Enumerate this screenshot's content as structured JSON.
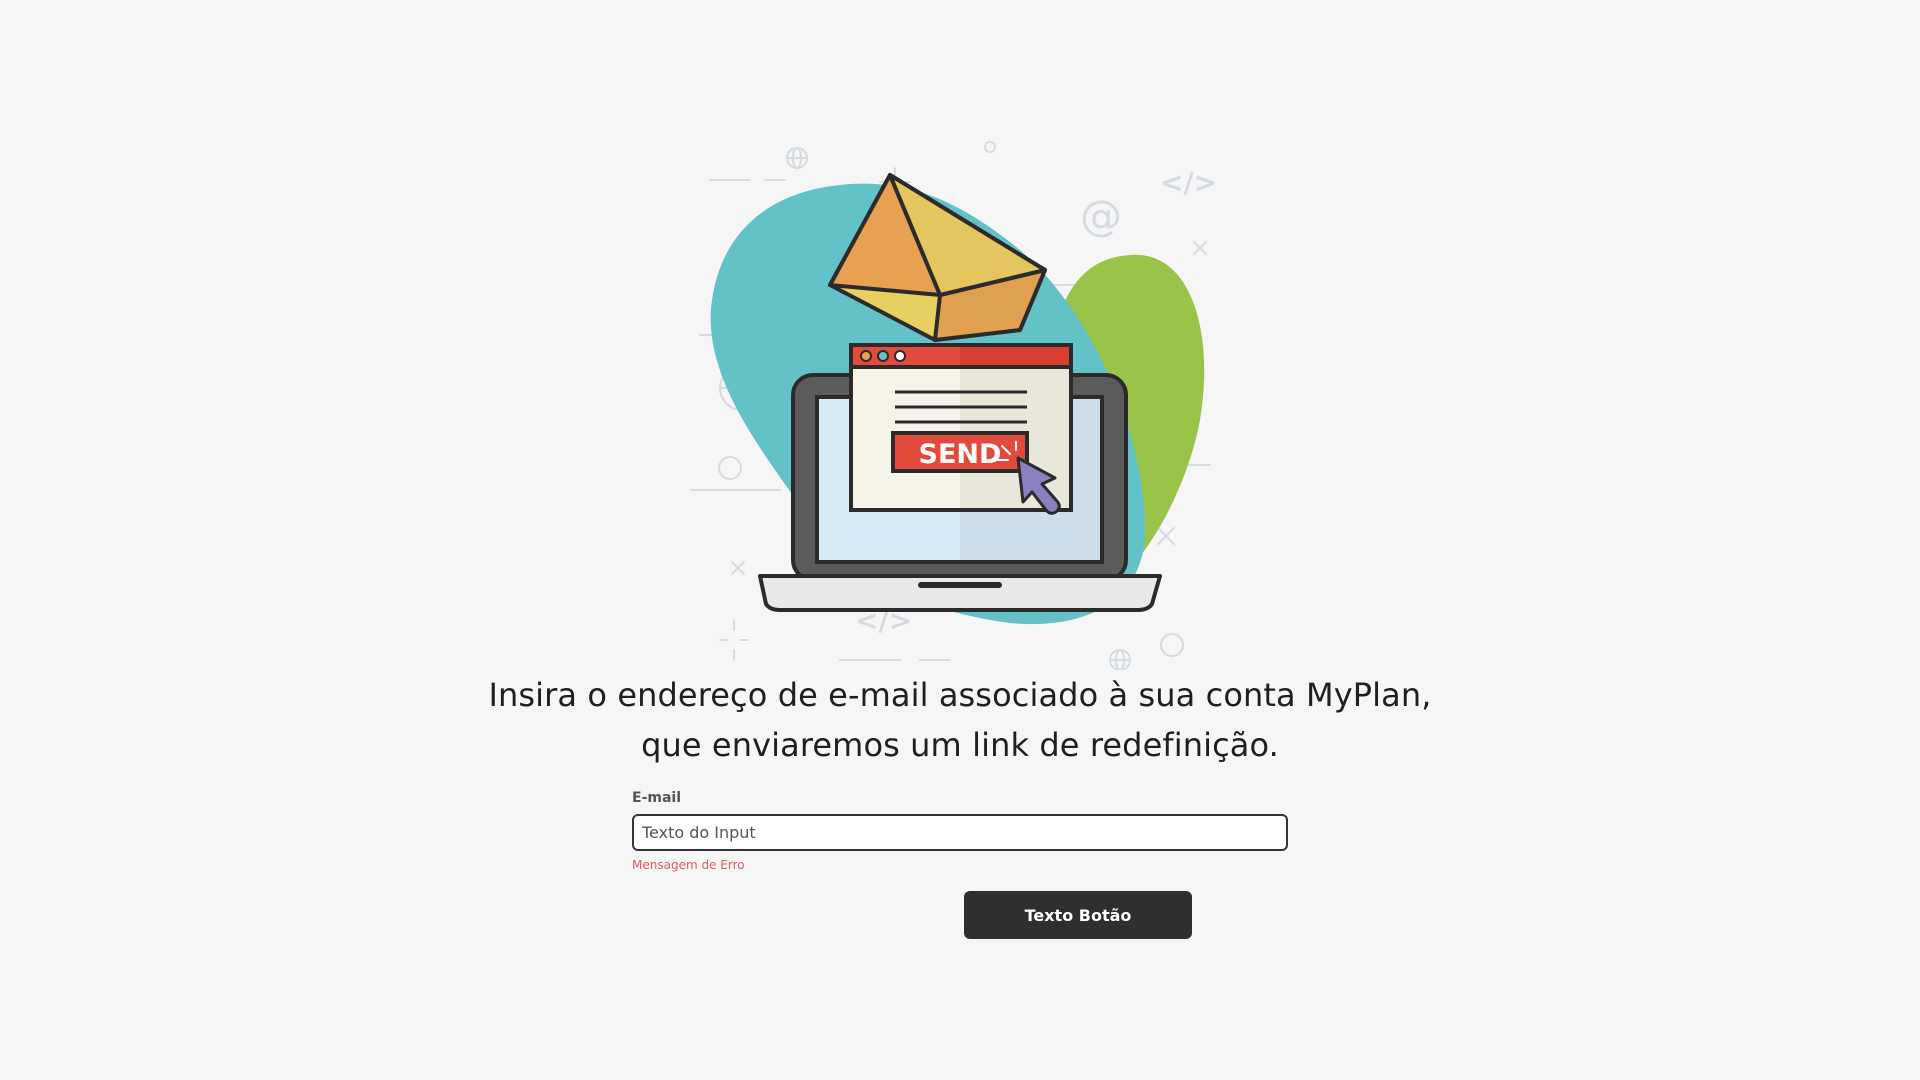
{
  "illustration": {
    "send_label": "SEND",
    "code_symbol": "</>",
    "at_symbol": "@",
    "cross_symbol": "×"
  },
  "headline": {
    "line1": "Insira o endereço de e-mail associado à sua conta MyPlan,",
    "line2": "que enviaremos um link de redefinição."
  },
  "form": {
    "email_label": "E-mail",
    "email_placeholder": "Texto do Input",
    "error_message": "Mensagem de Erro",
    "submit_label": "Texto Botão"
  },
  "colors": {
    "background": "#f6f6f6",
    "teal_blob": "#63c1c8",
    "green_blob": "#9ac34a",
    "button_bg": "#2f2f2f",
    "error": "#e05a61",
    "send_red": "#e24a3b"
  }
}
